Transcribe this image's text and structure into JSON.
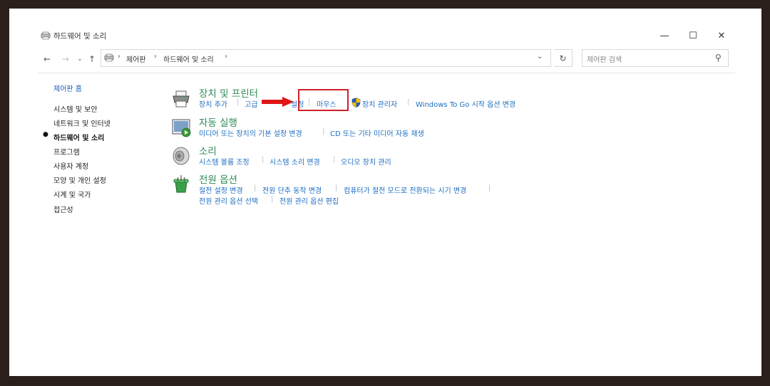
{
  "window": {
    "title": "하드웨어 및 소리",
    "controls": {
      "minimize": "—",
      "maximize": "☐",
      "close": "✕"
    }
  },
  "nav": {
    "back": "←",
    "forward": "→",
    "recent": "⌄",
    "up": "↑",
    "breadcrumb": [
      "제어판",
      "하드웨어 및 소리"
    ],
    "sep": "›",
    "dropdown": "⌄",
    "refresh": "↻",
    "search_placeholder": "제어판 검색",
    "search_icon_glyph": "⚲"
  },
  "sidebar": {
    "home": "제어판 홈",
    "items": [
      "시스템 및 보안",
      "네트워크 및 인터넷",
      "하드웨어 및 소리",
      "프로그램",
      "사용자 계정",
      "모양 및 개인 설정",
      "시계 및 국가",
      "접근성"
    ],
    "current_index": 2,
    "bullet": "●"
  },
  "categories": {
    "devices": {
      "title": "장치 및 프린터",
      "links": [
        "장치 추가",
        "고급",
        "설정",
        "마우스",
        "장치 관리자",
        "Windows To Go 시작 옵션 변경"
      ]
    },
    "autoplay": {
      "title": "자동 실행",
      "links": [
        "미디어 또는 장치의 기본 설정 변경",
        "CD 또는 기타 미디어 자동 재생"
      ]
    },
    "sound": {
      "title": "소리",
      "links": [
        "시스템 볼륨 조정",
        "시스템 소리 변경",
        "오디오 장치 관리"
      ]
    },
    "power": {
      "title": "전원 옵션",
      "links": [
        "절전 설정 변경",
        "전원 단추 동작 변경",
        "컴퓨터가 절전 모드로 전환되는 시기 변경"
      ],
      "links2": [
        "전원 관리 옵션 선택",
        "전원 관리 옵션 편집"
      ]
    }
  },
  "separator": "|",
  "colors": {
    "link": "#1e6fc0",
    "category": "#2e8b57",
    "highlight": "#d0202a",
    "arrow": "#e01515",
    "frame": "#2a1f1a"
  }
}
